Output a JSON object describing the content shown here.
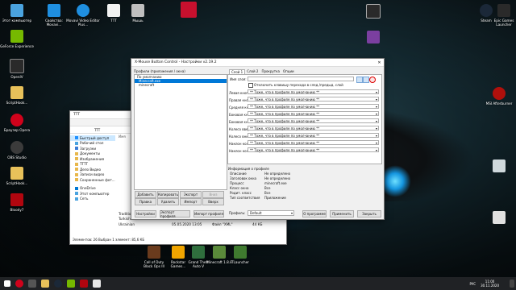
{
  "desktop_icons": [
    {
      "label": "Этот компьютер",
      "color": "#4aa3df"
    },
    {
      "label": "GeForce Experience",
      "color": "#76b900"
    },
    {
      "label": "OpenIV",
      "color": "#2a2a2a"
    },
    {
      "label": "ScriptHook...",
      "color": "#e8c15a"
    },
    {
      "label": "Браузер Opera",
      "color": "#d0021b"
    },
    {
      "label": "OBS Studio",
      "color": "#3b3b3b"
    },
    {
      "label": "ScriptHook...",
      "color": "#e8c15a"
    },
    {
      "label": "Bloody7",
      "color": "#b1060f"
    },
    {
      "label": "Свойства: Movavi...",
      "color": "#1f8fe0"
    },
    {
      "label": "Movavi Video Editor Plus...",
      "color": "#1f8fe0"
    },
    {
      "label": "ТТТ",
      "color": "#f2f2f2"
    },
    {
      "label": "Мышь",
      "color": "#bfbfbf"
    },
    {
      "label": "Steam",
      "color": "#1b2838"
    },
    {
      "label": "Epic Games Launcher",
      "color": "#2a2a2a"
    },
    {
      "label": "MSI Afterburner",
      "color": "#b0100c"
    }
  ],
  "explorer": {
    "title": "TTT",
    "address": "TTT",
    "sidebar": [
      "Быстрый доступ",
      "Рабочий стол",
      "Загрузки",
      "Документы",
      "Изображения",
      "TTTT",
      "Дело Видео",
      "Записи видео",
      "Сохраненные фот...",
      "OneDrive",
      "Этот компьютер",
      "Сеть"
    ],
    "header_name": "Имя",
    "files": [
      {
        "name": "Traditional Chinese",
        "date": "05.05.2020 13:05",
        "type": "Файл \"XML\"",
        "size": "34 КБ"
      },
      {
        "name": "Turkish",
        "date": "05.05.2020 13:05",
        "type": "Файл \"XML\"",
        "size": "31 КБ"
      },
      {
        "name": "Ukrainian",
        "date": "05.05.2020 13:05",
        "type": "Файл \"XML\"",
        "size": "44 КБ"
      }
    ],
    "status": "Элементов: 26     Выбран 1 элемент: 85,6 КБ"
  },
  "dialog": {
    "title": "X-Mouse Button Control - Настройки v2.19.2",
    "profiles_label": "Профили (приложения / окна)",
    "profiles": [
      "По умолчанию",
      "Minecraft.exe",
      "minecraft"
    ],
    "profile_buttons": [
      "Добавить",
      "Копировать",
      "Экспорт",
      "Вниз",
      "Правка",
      "Удалить",
      "Импорт",
      "Вверх"
    ],
    "tabs": [
      "Слой 1",
      "Слой 2",
      "Прокрутка",
      "Опции"
    ],
    "layer_name_label": "Имя слоя:",
    "checkbox_label": "Отключить клавишу перехода в след./предыд. слой",
    "rows": [
      {
        "label": "Левая кнопка",
        "value": "** Тоже, что в профиле по умолчанию **"
      },
      {
        "label": "Правая кнопка",
        "value": "** Тоже, что в профиле по умолчанию **"
      },
      {
        "label": "Средняя кнопка",
        "value": "** Тоже, что в профиле по умолчанию **"
      },
      {
        "label": "Боковая кнопка 4",
        "value": "** Тоже, что в профиле по умолчанию **"
      },
      {
        "label": "Боковая кнопка 5",
        "value": "** Тоже, что в профиле по умолчанию **"
      },
      {
        "label": "Колесо вверх",
        "value": "** Тоже, что в профиле по умолчанию **"
      },
      {
        "label": "Колесо вниз",
        "value": "** Тоже, что в профиле по умолчанию **"
      },
      {
        "label": "Наклон колеса влево",
        "value": "** Тоже, что в профиле по умолчанию **"
      },
      {
        "label": "Наклон колеса вправо",
        "value": "** Тоже, что в профиле по умолчанию **"
      }
    ],
    "info_title": "Информация о профиле",
    "info": [
      {
        "k": "Описание",
        "v": "Не определено"
      },
      {
        "k": "Заголовок окна",
        "v": "Не определено"
      },
      {
        "k": "Процесс",
        "v": "minecraft.exe"
      },
      {
        "k": "Класс окна",
        "v": "Все"
      },
      {
        "k": "Родит. класс",
        "v": "Все"
      },
      {
        "k": "Тип соответствия",
        "v": "Приложение"
      }
    ],
    "bottom_buttons": [
      "Настройки",
      "Экспорт профиля",
      "Импорт профиля"
    ],
    "profiles_drop_label": "Профиль:",
    "profiles_drop_value": "Default",
    "action_buttons": [
      "О программе",
      "Применить",
      "Закрыть"
    ]
  },
  "taskbar": {
    "lang": "РУС",
    "time": "11:00",
    "date": "30.11.2020",
    "pinned": [
      {
        "label": "Call of Duty Black Ops III",
        "color": "#6a3b1d"
      },
      {
        "label": "Rockstar Games...",
        "color": "#f0a500"
      },
      {
        "label": "Grand Theft Auto V",
        "color": "#2f6f3d"
      },
      {
        "label": "Minecraft 1.8.8",
        "color": "#5a8a3a"
      },
      {
        "label": "TLauncher",
        "color": "#3f7a2f"
      }
    ]
  }
}
